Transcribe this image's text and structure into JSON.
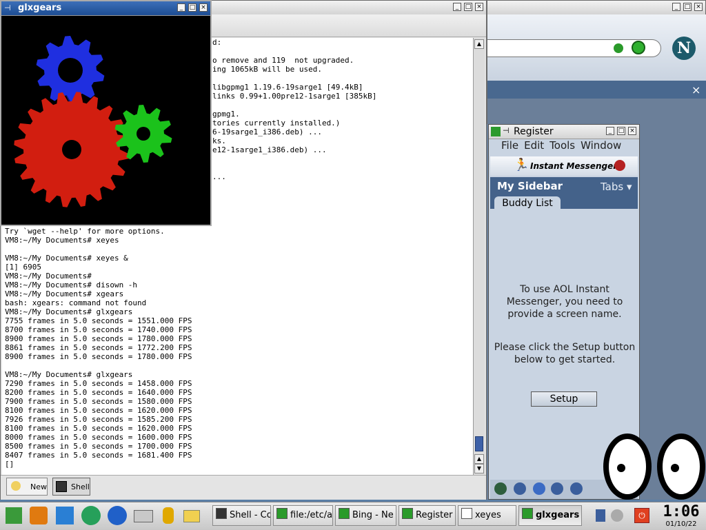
{
  "colors": {
    "desktop": "#5b7fa6",
    "gear_blue": "#1f2fe0",
    "gear_red": "#d21e10",
    "gear_green": "#1bc21b",
    "aim_header": "#44628a",
    "aim_tab_bg": "#6f8bb0"
  },
  "glxgears_window": {
    "title": "glxgears"
  },
  "terminal_window": {
    "lines_top": [
      "d:",
      "",
      "o remove and 119  not upgraded.",
      "ing 1065kB will be used.",
      "",
      "libgpmg1 1.19.6-19sarge1 [49.4kB]",
      "links 0.99+1.00pre12-1sarge1 [385kB]",
      "",
      "gpmg1.",
      "tories currently installed.)",
      "6-19sarge1_i386.deb) ...",
      "ks.",
      "e12-1sarge1_i386.deb) ...",
      "",
      "",
      "..."
    ],
    "lines_bottom": [
      "Try `wget --help' for more options.",
      "VM8:~/My Documents# xeyes",
      "",
      "VM8:~/My Documents# xeyes &",
      "[1] 6905",
      "VM8:~/My Documents#",
      "VM8:~/My Documents# disown -h",
      "VM8:~/My Documents# xgears",
      "bash: xgears: command not found",
      "VM8:~/My Documents# glxgears",
      "7755 frames in 5.0 seconds = 1551.000 FPS",
      "8700 frames in 5.0 seconds = 1740.000 FPS",
      "8900 frames in 5.0 seconds = 1780.000 FPS",
      "8861 frames in 5.0 seconds = 1772.200 FPS",
      "8900 frames in 5.0 seconds = 1780.000 FPS",
      "",
      "VM8:~/My Documents# glxgears",
      "7290 frames in 5.0 seconds = 1458.000 FPS",
      "8200 frames in 5.0 seconds = 1640.000 FPS",
      "7900 frames in 5.0 seconds = 1580.000 FPS",
      "8100 frames in 5.0 seconds = 1620.000 FPS",
      "7926 frames in 5.0 seconds = 1585.200 FPS",
      "8100 frames in 5.0 seconds = 1620.000 FPS",
      "8000 frames in 5.0 seconds = 1600.000 FPS",
      "8500 frames in 5.0 seconds = 1700.000 FPS",
      "8407 frames in 5.0 seconds = 1681.400 FPS",
      "[]"
    ],
    "new_label": "New",
    "shell_label": "Shell"
  },
  "browser_window": {
    "logo_letter": "N",
    "close_x": "×"
  },
  "aim_window": {
    "title": "Register",
    "menu": [
      "File",
      "Edit",
      "Tools",
      "Window"
    ],
    "brand": "Instant Messenger",
    "sidebar_title": "My Sidebar",
    "tabs_label": "Tabs",
    "tab_buddy": "Buddy List",
    "message1": "To use AOL Instant Messenger, you need to provide a screen name.",
    "message2": "Please click the Setup button below to get started.",
    "setup_button": "Setup"
  },
  "taskbar": {
    "launchers": [
      "kde-menu-icon",
      "safe-icon",
      "cube-icon",
      "runner-icon",
      "globe-icon",
      "printer-icon",
      "aim-runner-icon",
      "mail-icon",
      "pencil-icon"
    ],
    "items": [
      {
        "label": "Shell - Co",
        "icon": "terminal-icon"
      },
      {
        "label": "file:/etc/ap",
        "icon": "pencil-icon"
      },
      {
        "label": "Bing - Ne",
        "icon": "aim-icon"
      },
      {
        "label": "Register",
        "icon": "aim-icon"
      },
      {
        "label": "xeyes",
        "icon": "eyes-icon"
      },
      {
        "label": "glxgears",
        "icon": "aim-icon"
      }
    ],
    "clock_time": "1:06",
    "clock_date": "01/10/22"
  }
}
